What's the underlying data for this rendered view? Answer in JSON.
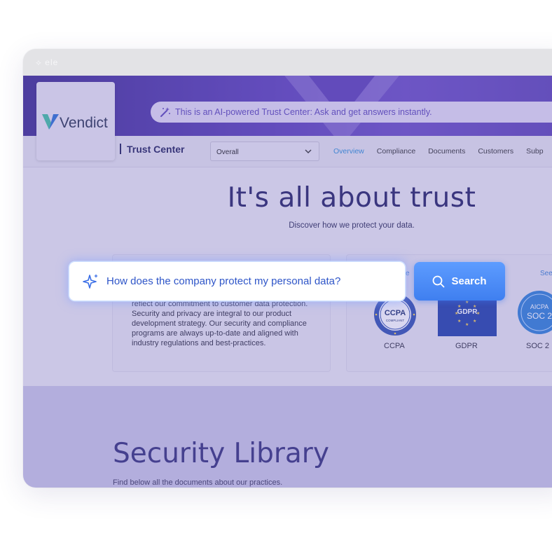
{
  "window": {
    "titlebar_text": "⟡ ele"
  },
  "banner": {
    "ai_notice": "This is an AI-powered Trust Center: Ask and get answers instantly."
  },
  "brand": {
    "name": "Vendict",
    "section": "Trust Center"
  },
  "filter": {
    "selected": "Overall"
  },
  "nav": {
    "items": [
      "Overview",
      "Compliance",
      "Documents",
      "Customers",
      "Subp"
    ],
    "active_index": 0
  },
  "hero": {
    "title": "It's all about trust",
    "subtitle": "Discover how we protect your data."
  },
  "intro_card": {
    "text": "reflect our commitment to customer data protection. Security and privacy are integral to our product development strategy. Our security and compliance programs are always up-to-date and aligned with industry regulations and best-practices."
  },
  "certs_card": {
    "see_link": "See",
    "partial_label": "e",
    "badges": [
      {
        "label": "CCPA",
        "badge_text": "CCPA",
        "badge_sub": "COMPLIANT"
      },
      {
        "label": "GDPR",
        "badge_text": "GDPR"
      },
      {
        "label": "SOC 2",
        "badge_text_top": "AICPA",
        "badge_text": "SOC 2"
      }
    ]
  },
  "search": {
    "query": "How does the company protect my personal data?",
    "button_label": "Search"
  },
  "library": {
    "title": "Security Library",
    "subtitle": "Find below all the documents about our practices."
  },
  "colors": {
    "banner": "#4b33a6",
    "accent_blue": "#3f7ff0",
    "heading": "#232063"
  }
}
